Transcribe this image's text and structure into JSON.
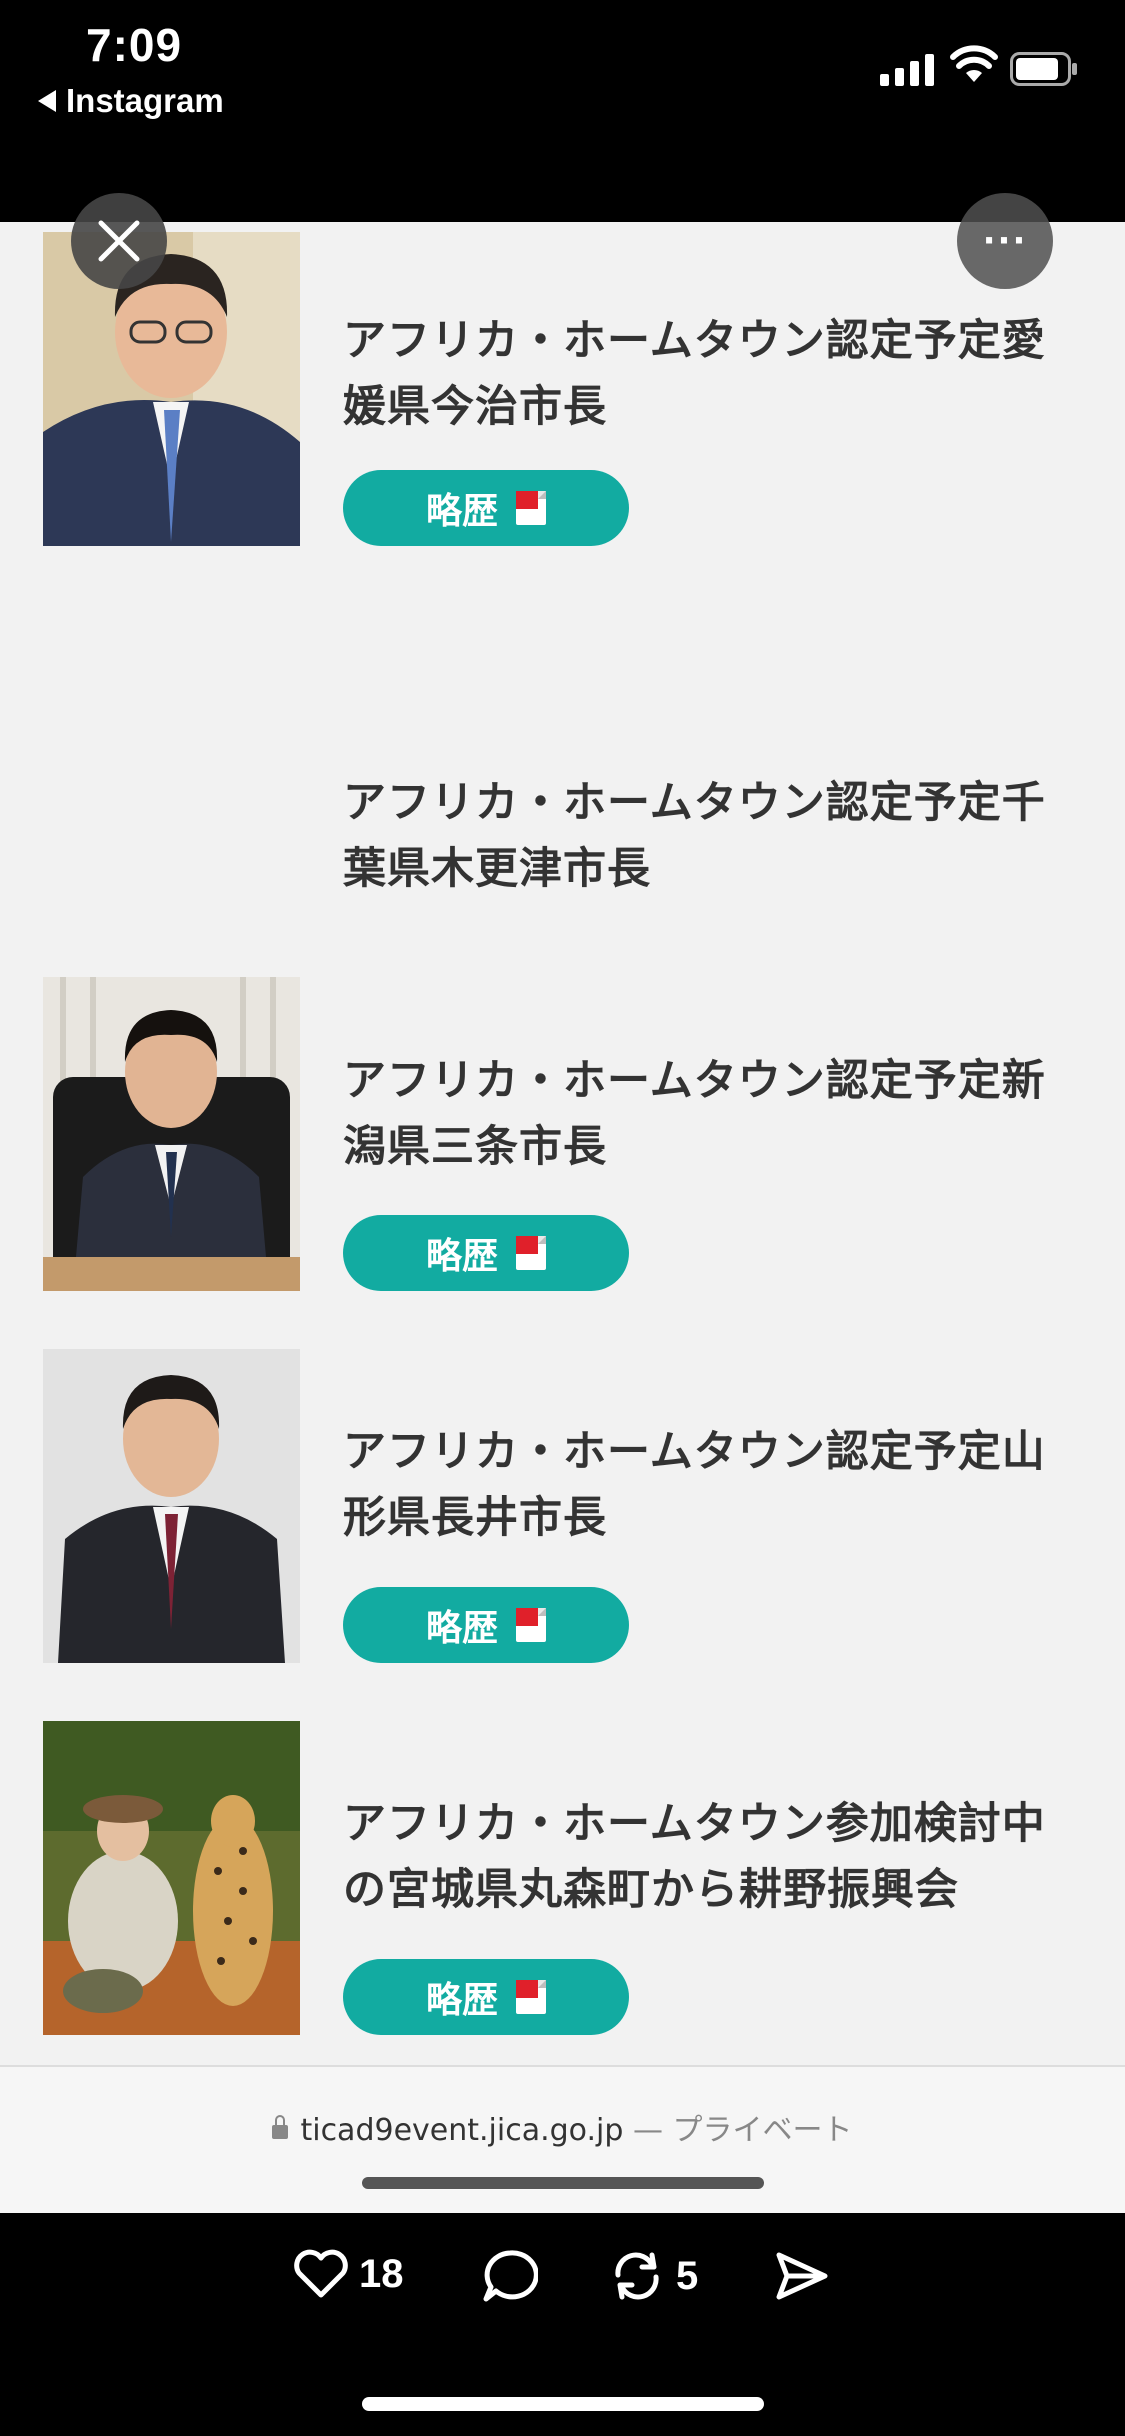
{
  "status_bar": {
    "time": "7:09",
    "back_app": "Instagram"
  },
  "list": [
    {
      "title": "アフリカ・ホームタウン認定予定愛媛県今治市長",
      "button": "略歴",
      "has_photo": true
    },
    {
      "title": "アフリカ・ホームタウン認定予定千葉県木更津市長",
      "has_photo": false
    },
    {
      "title": "アフリカ・ホームタウン認定予定新潟県三条市長",
      "button": "略歴",
      "has_photo": true
    },
    {
      "title": "アフリカ・ホームタウン認定予定山形県長井市長",
      "button": "略歴",
      "has_photo": true
    },
    {
      "title": "アフリカ・ホームタウン参加検討中の宮城県丸森町から耕野振興会",
      "button": "略歴",
      "has_photo": true
    }
  ],
  "browser": {
    "domain": "ticad9event.jica.go.jp",
    "privacy": "— プライベート"
  },
  "actions": {
    "likes": "18",
    "reposts": "5"
  },
  "colors": {
    "accent": "#12aba1",
    "pdf_red": "#e0202a",
    "page_bg": "#f2f2f2"
  }
}
